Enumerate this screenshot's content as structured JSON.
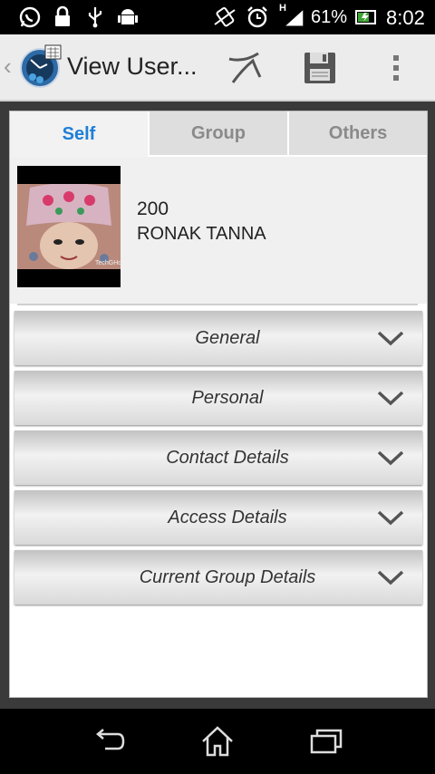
{
  "status_bar": {
    "icons": [
      "whatsapp-icon",
      "lock-icon",
      "usb-icon",
      "android-debug-icon",
      "vibrate-icon",
      "alarm-icon",
      "signal-icon",
      "battery-icon"
    ],
    "signal_label": "H",
    "battery_percent": "61%",
    "time": "8:02"
  },
  "action_bar": {
    "title": "View User...",
    "actions": [
      "cancel-icon",
      "save-icon",
      "overflow-menu-icon"
    ]
  },
  "tabs": [
    {
      "label": "Self",
      "active": true
    },
    {
      "label": "Group",
      "active": false
    },
    {
      "label": "Others",
      "active": false
    }
  ],
  "profile": {
    "id": "200",
    "name": "RONAK TANNA",
    "photo_watermark": "TechGHd"
  },
  "sections": [
    {
      "label": "General"
    },
    {
      "label": "Personal"
    },
    {
      "label": "Contact Details"
    },
    {
      "label": "Access Details"
    },
    {
      "label": "Current Group Details"
    }
  ],
  "nav_bar": [
    "back-icon",
    "home-icon",
    "recent-apps-icon"
  ],
  "colors": {
    "tab_active": "#1e7fd8",
    "tab_inactive": "#8a8a8a",
    "action_bar": "#ececec"
  }
}
